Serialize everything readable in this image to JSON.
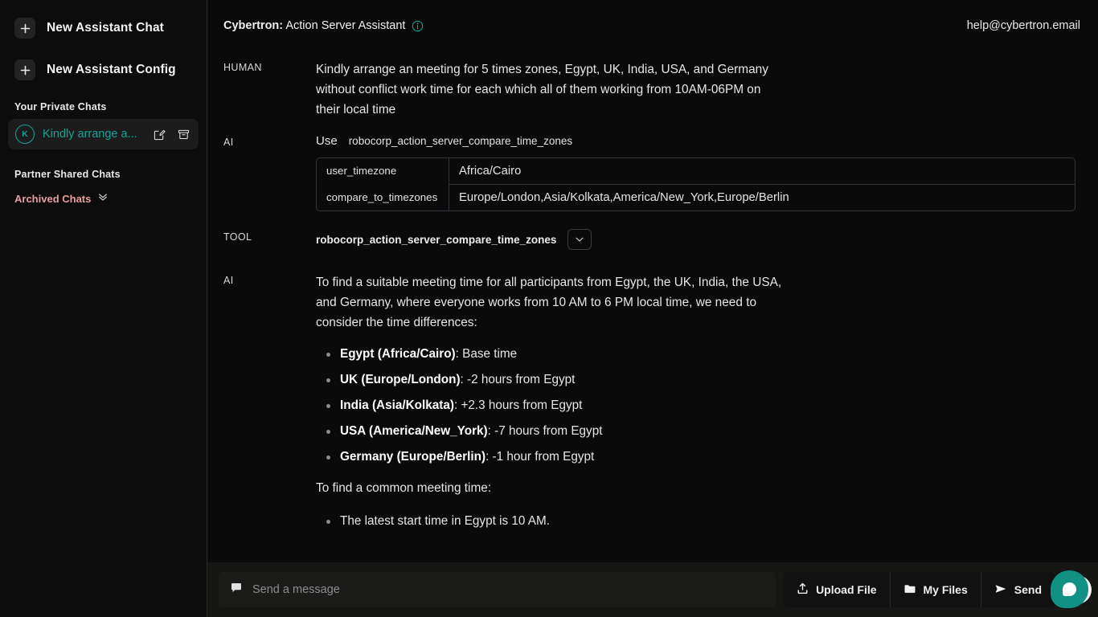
{
  "sidebar": {
    "new_buttons": [
      {
        "label": "New Assistant Chat",
        "icon": "plus-icon"
      },
      {
        "label": "New Assistant Config",
        "icon": "plus-icon"
      }
    ],
    "private_chats_label": "Your Private Chats",
    "chats": [
      {
        "avatar": "K",
        "title": "Kindly arrange a...",
        "edit_icon": "edit-pencil-icon",
        "archive_icon": "archive-box-icon",
        "active": true
      }
    ],
    "partner_chats_label": "Partner Shared Chats",
    "archived_label": "Archived Chats",
    "archived_icon": "double-chevron-down-icon",
    "accent_color": "#16a394",
    "archived_color": "#e79e9e"
  },
  "header": {
    "brand": "Cybertron:",
    "subtitle": "Action Server Assistant",
    "info_icon": "info-circle-icon",
    "account_email": "help@cybertron.email"
  },
  "conversation": [
    {
      "role": "HUMAN",
      "text": "Kindly arrange an meeting for 5 times zones, Egypt, UK, India, USA, and Germany without conflict work time for each which all of them working from 10AM-06PM on their local time"
    },
    {
      "role": "AI",
      "use_word": "Use",
      "function_name": "robocorp_action_server_compare_time_zones",
      "arguments": [
        {
          "key": "user_timezone",
          "value": "Africa/Cairo"
        },
        {
          "key": "compare_to_timezones",
          "value": "Europe/London,Asia/Kolkata,America/New_York,Europe/Berlin"
        }
      ]
    },
    {
      "role": "TOOL",
      "tool_name": "robocorp_action_server_compare_time_zones",
      "expand_icon": "chevron-down-icon"
    },
    {
      "role": "AI",
      "intro": "To find a suitable meeting time for all participants from Egypt, the UK, India, the USA, and Germany, where everyone works from 10 AM to 6 PM local time, we need to consider the time differences:",
      "bullets": [
        {
          "bold": "Egypt (Africa/Cairo)",
          "rest": ": Base time"
        },
        {
          "bold": "UK (Europe/London)",
          "rest": ": -2 hours from Egypt"
        },
        {
          "bold": "India (Asia/Kolkata)",
          "rest": ": +2.3 hours from Egypt"
        },
        {
          "bold": "USA (America/New_York)",
          "rest": ": -7 hours from Egypt"
        },
        {
          "bold": "Germany (Europe/Berlin)",
          "rest": ": -1 hour from Egypt"
        }
      ],
      "outro": "To find a common meeting time:",
      "bullets2": [
        {
          "bold": "",
          "rest": "The latest start time in Egypt is 10 AM."
        }
      ]
    }
  ],
  "composer": {
    "placeholder": "Send a message",
    "message_icon": "chat-bubble-icon",
    "buttons": [
      {
        "label": "Upload File",
        "icon": "upload-icon"
      },
      {
        "label": "My Files",
        "icon": "folder-icon"
      },
      {
        "label": "Send",
        "icon": "send-paper-plane-icon"
      }
    ],
    "mic_icon": "microphone-icon",
    "fab_icon": "chat-assistant-bubble-icon",
    "fab_color": "#109184"
  }
}
